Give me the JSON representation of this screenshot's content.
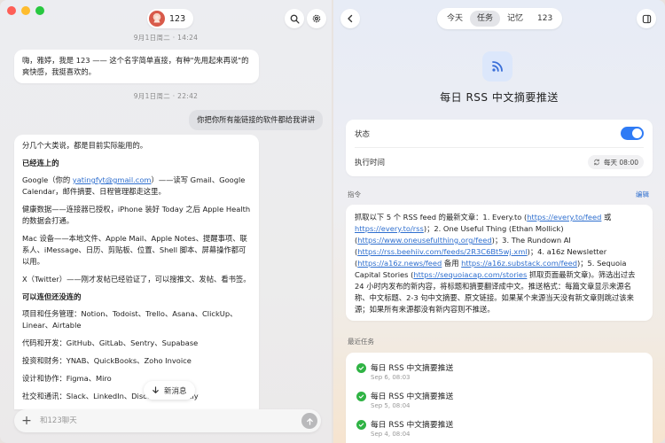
{
  "chat": {
    "contact_name": "123",
    "timestamp1": "9月1日周二 · 14:24",
    "msg1": "嗨，雅婷，我是 123 —— 这个名字简单直接，有种\"先用起来再说\"的爽快感，我挺喜欢的。",
    "timestamp2": "9月1日周二 · 22:42",
    "user_msg": "你把你所有能链接的软件都给我讲讲",
    "reply": {
      "intro": "分几个大类说，都是目前实际能用的。",
      "h1": "已经连上的",
      "google_pre": "Google（你的 ",
      "google_link": "yatingfyt@gmail.com",
      "google_post": "）——读写 Gmail、Google Calendar，邮件摘要、日程管理都走这里。",
      "health": "健康数据——连接器已授权，iPhone 装好 Today 之后 Apple Health 的数据会打通。",
      "mac": "Mac 设备——本地文件、Apple Mail、Apple Notes、提醒事项、联系人、iMessage、日历、剪贴板、位置、Shell 脚本、屏幕操作都可以用。",
      "x": "X（Twitter）——刚才发帖已经验证了，可以搜推文、发帖、看书签。",
      "h2": "可以连但还没连的",
      "pm": "项目和任务管理：Notion、Todoist、Trello、Asana、ClickUp、Linear、Airtable",
      "dev": "代码和开发：GitHub、GitLab、Sentry、Supabase",
      "fin": "投资和财务：YNAB、QuickBooks、Zoho Invoice",
      "design": "设计和协作：Figma、Miro",
      "social": "社交和通讯：Slack、LinkedIn、Discord、Calendly"
    },
    "new_messages": "新消息",
    "input_placeholder": "和123聊天"
  },
  "task_panel": {
    "tabs": [
      "今天",
      "任务",
      "记忆",
      "123"
    ],
    "active_tab": "任务",
    "title": "每日 RSS 中文摘要推送",
    "status_label": "状态",
    "status_on": true,
    "exec_time_label": "执行时间",
    "exec_time_value": "每天 08:00",
    "instruction_label": "指令",
    "edit_label": "编辑",
    "instruction": {
      "p1": "抓取以下 5 个 RSS feed 的最新文章：1. Every.to (",
      "l1": "https://every.to/feed",
      "p2": " 或 ",
      "l2": "https://every.to/rss",
      "p3": ")；2. One Useful Thing (Ethan Mollick) (",
      "l3": "https://www.oneusefulthing.org/feed",
      "p4": ")；3. The Rundown AI (",
      "l4": "https://rss.beehiiv.com/feeds/2R3C6Bt5wj.xml",
      "p5": ")；4. a16z Newsletter (",
      "l5": "https://a16z.news/feed",
      "p6": " 备用 ",
      "l6": "https://a16z.substack.com/feed",
      "p7": ")；5. Sequoia Capital Stories (",
      "l7": "https://sequoiacap.com/stories",
      "p8": " 抓取页面最新文章)。筛选出过去 24 小时内发布的新内容，将标题和摘要翻译成中文。推送格式：每篇文章显示来源名称、中文标题、2-3 句中文摘要、原文链接。如果某个来源当天没有新文章则跳过该来源；如果所有来源都没有新内容则不推送。"
    },
    "recent_label": "最近任务",
    "recent": [
      {
        "name": "每日 RSS 中文摘要推送",
        "date": "Sep 6, 08:03"
      },
      {
        "name": "每日 RSS 中文摘要推送",
        "date": "Sep 5, 08:04"
      },
      {
        "name": "每日 RSS 中文摘要推送",
        "date": "Sep 4, 08:04"
      }
    ]
  }
}
